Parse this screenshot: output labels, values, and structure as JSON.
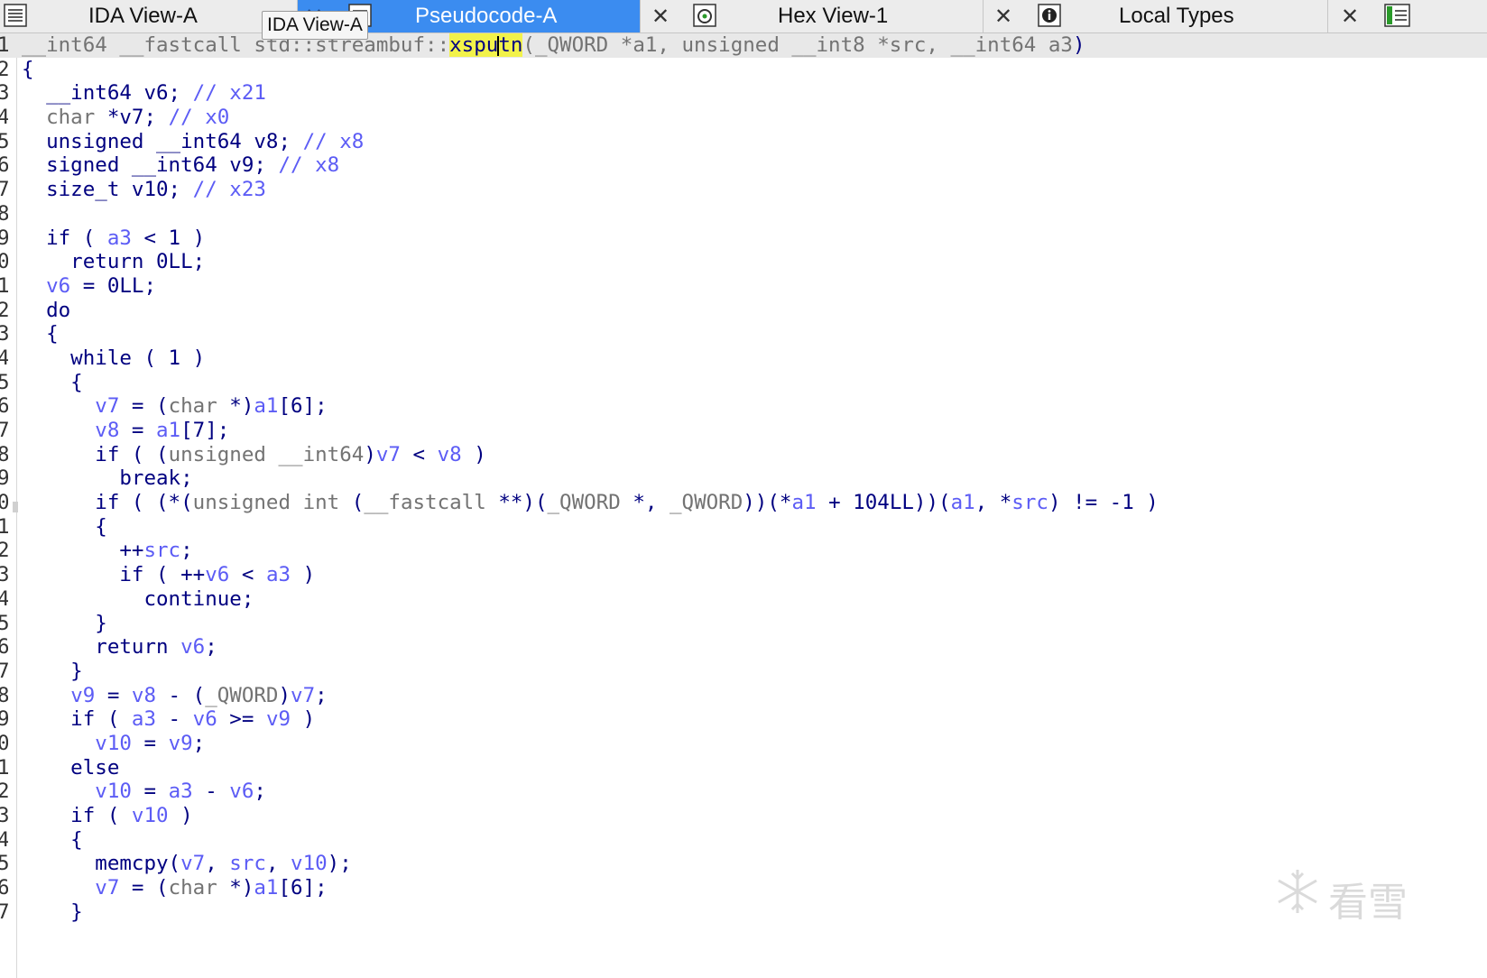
{
  "tabs": [
    {
      "label": "IDA View-A",
      "icon": "text-view-icon",
      "active": false
    },
    {
      "label": "Pseudocode-A",
      "icon": "pseudocode-icon",
      "active": true
    },
    {
      "label": "Hex View-1",
      "icon": "hex-view-icon",
      "active": false
    },
    {
      "label": "Local Types",
      "icon": "local-types-icon",
      "active": false
    }
  ],
  "close_glyph": "✕",
  "tooltip": "IDA View-A",
  "accent_color": "#3b8cf0",
  "code": {
    "line_numbers": [
      "1",
      "2",
      "3",
      "4",
      "5",
      "6",
      "7",
      "8",
      "9",
      "0",
      "1",
      "2",
      "3",
      "4",
      "5",
      "6",
      "7",
      "8",
      "9",
      "0",
      "1",
      "2",
      "3",
      "4",
      "5",
      "6",
      "7",
      "8",
      "9",
      "0",
      "1",
      "2",
      "3",
      "4",
      "5",
      "6",
      "7"
    ],
    "lines": [
      "__int64 __fastcall std::streambuf::xsputn(_QWORD *a1, unsigned __int8 *src, __int64 a3)",
      "{",
      "  __int64 v6; // x21",
      "  char *v7; // x0",
      "  unsigned __int64 v8; // x8",
      "  signed __int64 v9; // x8",
      "  size_t v10; // x23",
      "",
      "  if ( a3 < 1 )",
      "    return 0LL;",
      "  v6 = 0LL;",
      "  do",
      "  {",
      "    while ( 1 )",
      "    {",
      "      v7 = (char *)a1[6];",
      "      v8 = a1[7];",
      "      if ( (unsigned __int64)v7 < v8 )",
      "        break;",
      "      if ( (*(unsigned int (__fastcall **)(_QWORD *, _QWORD))(*a1 + 104LL))(a1, *src) != -1 )",
      "      {",
      "        ++src;",
      "        if ( ++v6 < a3 )",
      "          continue;",
      "      }",
      "      return v6;",
      "    }",
      "    v9 = v8 - (_QWORD)v7;",
      "    if ( a3 - v6 >= v9 )",
      "      v10 = v9;",
      "    else",
      "      v10 = a3 - v6;",
      "    if ( v10 )",
      "    {",
      "      memcpy(v7, src, v10);",
      "      v7 = (char *)a1[6];",
      "    }"
    ]
  },
  "highlighted_identifier": "xsputn",
  "watermark_text": "看雪"
}
